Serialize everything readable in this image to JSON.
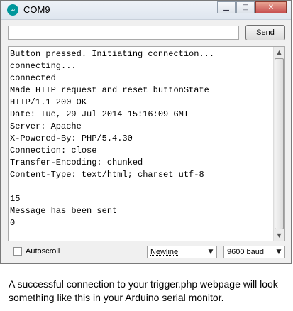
{
  "window": {
    "title": "COM9",
    "app_icon_glyph": "∞",
    "icon_color": "#00979c",
    "controls": {
      "minimize": "▁",
      "maximize": "□",
      "close": "✕"
    }
  },
  "send_bar": {
    "input_value": "",
    "send_label": "Send"
  },
  "console": {
    "lines": [
      "Button pressed. Initiating connection...",
      "connecting...",
      "connected",
      "Made HTTP request and reset buttonState",
      "HTTP/1.1 200 OK",
      "Date: Tue, 29 Jul 2014 15:16:09 GMT",
      "Server: Apache",
      "X-Powered-By: PHP/5.4.30",
      "Connection: close",
      "Transfer-Encoding: chunked",
      "Content-Type: text/html; charset=utf-8",
      "",
      "15",
      "Message has been sent",
      "0"
    ]
  },
  "bottom_bar": {
    "autoscroll_label": "Autoscroll",
    "autoscroll_checked": false,
    "line_ending": "Newline",
    "baud_rate": "9600 baud"
  },
  "caption": "A successful connection to your trigger.php webpage will look something like this in your Arduino serial monitor."
}
